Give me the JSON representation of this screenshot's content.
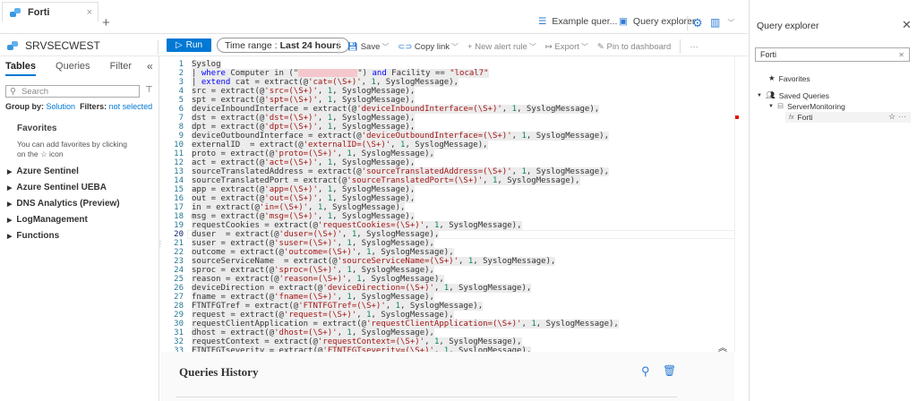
{
  "tab": {
    "title": "Forti",
    "close": "×",
    "new_tab": "+"
  },
  "topbar": {
    "example_queries": "Example quer...",
    "query_explorer": "Query explorer"
  },
  "workspace": "SRVSECWEST",
  "toolbar": {
    "run": "Run",
    "time_range_label": "Time range :",
    "time_range_value": "Last 24 hours",
    "save": "Save",
    "copy_link": "Copy link",
    "new_alert_rule": "New alert rule",
    "export": "Export",
    "pin": "Pin to dashboard",
    "more": "···"
  },
  "left_panel": {
    "tabs": [
      "Tables",
      "Queries",
      "Filter"
    ],
    "active_tab": "Tables",
    "search_placeholder": "Search",
    "group_by_label": "Group by:",
    "group_by_value": "Solution",
    "filters_label": "Filters:",
    "filters_value": "not selected",
    "favorites_title": "Favorites",
    "favorites_hint": "You can add favorites by clicking on the ☆ icon",
    "categories": [
      "Azure Sentinel",
      "Azure Sentinel UEBA",
      "DNS Analytics (Preview)",
      "LogManagement",
      "Functions"
    ]
  },
  "editor": {
    "lines": [
      [
        [
          "p",
          "Syslog"
        ]
      ],
      [
        [
          "p",
          "| "
        ],
        [
          "k",
          "where"
        ],
        [
          "p",
          " Computer in (\""
        ],
        [
          "r",
          ""
        ],
        [
          "p",
          "\") "
        ],
        [
          "k",
          "and"
        ],
        [
          "p",
          " Facility == "
        ],
        [
          "s",
          "\"local7\""
        ]
      ],
      [
        [
          "p",
          "| "
        ],
        [
          "k",
          "extend"
        ],
        [
          "p",
          " cat = extract(@"
        ],
        [
          "s",
          "'cat=(\\S+)'"
        ],
        [
          "p",
          ", "
        ],
        [
          "n",
          "1"
        ],
        [
          "p",
          ", SyslogMessage),"
        ]
      ],
      [
        [
          "p",
          "src = extract(@"
        ],
        [
          "s",
          "'src=(\\S+)'"
        ],
        [
          "p",
          ", "
        ],
        [
          "n",
          "1"
        ],
        [
          "p",
          ", SyslogMessage),"
        ]
      ],
      [
        [
          "p",
          "spt = extract(@"
        ],
        [
          "s",
          "'spt=(\\S+)'"
        ],
        [
          "p",
          ", "
        ],
        [
          "n",
          "1"
        ],
        [
          "p",
          ", SyslogMessage),"
        ]
      ],
      [
        [
          "p",
          "deviceInboundInterface = extract(@"
        ],
        [
          "s",
          "'deviceInboundInterface=(\\S+)'"
        ],
        [
          "p",
          ", "
        ],
        [
          "n",
          "1"
        ],
        [
          "p",
          ", SyslogMessage),"
        ]
      ],
      [
        [
          "p",
          "dst = extract(@"
        ],
        [
          "s",
          "'dst=(\\S+)'"
        ],
        [
          "p",
          ", "
        ],
        [
          "n",
          "1"
        ],
        [
          "p",
          ", SyslogMessage),"
        ]
      ],
      [
        [
          "p",
          "dpt = extract(@"
        ],
        [
          "s",
          "'dpt=(\\S+)'"
        ],
        [
          "p",
          ", "
        ],
        [
          "n",
          "1"
        ],
        [
          "p",
          ", SyslogMessage),"
        ]
      ],
      [
        [
          "p",
          "deviceOutboundInterface = extract(@"
        ],
        [
          "s",
          "'deviceOutboundInterface=(\\S+)'"
        ],
        [
          "p",
          ", "
        ],
        [
          "n",
          "1"
        ],
        [
          "p",
          ", SyslogMessage),"
        ]
      ],
      [
        [
          "p",
          "externalID  = extract(@"
        ],
        [
          "s",
          "'externalID=(\\S+)'"
        ],
        [
          "p",
          ", "
        ],
        [
          "n",
          "1"
        ],
        [
          "p",
          ", SyslogMessage),"
        ]
      ],
      [
        [
          "p",
          "proto = extract(@"
        ],
        [
          "s",
          "'proto=(\\S+)'"
        ],
        [
          "p",
          ", "
        ],
        [
          "n",
          "1"
        ],
        [
          "p",
          ", SyslogMessage),"
        ]
      ],
      [
        [
          "p",
          "act = extract(@"
        ],
        [
          "s",
          "'act=(\\S+)'"
        ],
        [
          "p",
          ", "
        ],
        [
          "n",
          "1"
        ],
        [
          "p",
          ", SyslogMessage),"
        ]
      ],
      [
        [
          "p",
          "sourceTranslatedAddress = extract(@"
        ],
        [
          "s",
          "'sourceTranslatedAddress=(\\S+)'"
        ],
        [
          "p",
          ", "
        ],
        [
          "n",
          "1"
        ],
        [
          "p",
          ", SyslogMessage),"
        ]
      ],
      [
        [
          "p",
          "sourceTranslatedPort = extract(@"
        ],
        [
          "s",
          "'sourceTranslatedPort=(\\S+)'"
        ],
        [
          "p",
          ", "
        ],
        [
          "n",
          "1"
        ],
        [
          "p",
          ", SyslogMessage),"
        ]
      ],
      [
        [
          "p",
          "app = extract(@"
        ],
        [
          "s",
          "'app=(\\S+)'"
        ],
        [
          "p",
          ", "
        ],
        [
          "n",
          "1"
        ],
        [
          "p",
          ", SyslogMessage),"
        ]
      ],
      [
        [
          "p",
          "out = extract(@"
        ],
        [
          "s",
          "'out=(\\S+)'"
        ],
        [
          "p",
          ", "
        ],
        [
          "n",
          "1"
        ],
        [
          "p",
          ", SyslogMessage),"
        ]
      ],
      [
        [
          "p",
          "in = extract(@"
        ],
        [
          "s",
          "'in=(\\S+)'"
        ],
        [
          "p",
          ", "
        ],
        [
          "n",
          "1"
        ],
        [
          "p",
          ", SyslogMessage),"
        ]
      ],
      [
        [
          "p",
          "msg = extract(@"
        ],
        [
          "s",
          "'msg=(\\S+)'"
        ],
        [
          "p",
          ", "
        ],
        [
          "n",
          "1"
        ],
        [
          "p",
          ", SyslogMessage),"
        ]
      ],
      [
        [
          "p",
          "requestCookies = extract(@"
        ],
        [
          "s",
          "'requestCookies=(\\S+)'"
        ],
        [
          "p",
          ", "
        ],
        [
          "n",
          "1"
        ],
        [
          "p",
          ", SyslogMessage),"
        ]
      ],
      [
        [
          "p",
          "duser  = extract(@"
        ],
        [
          "s",
          "'duser=(\\S+)'"
        ],
        [
          "p",
          ", "
        ],
        [
          "n",
          "1"
        ],
        [
          "p",
          ", SyslogMessage),"
        ]
      ],
      [
        [
          "p",
          "suser = extract(@"
        ],
        [
          "s",
          "'suser=(\\S+)'"
        ],
        [
          "p",
          ", "
        ],
        [
          "n",
          "1"
        ],
        [
          "p",
          ", SyslogMessage),"
        ]
      ],
      [
        [
          "p",
          "outcome = extract(@"
        ],
        [
          "s",
          "'outcome=(\\S+)'"
        ],
        [
          "p",
          ", "
        ],
        [
          "n",
          "1"
        ],
        [
          "p",
          ", SyslogMessage),"
        ]
      ],
      [
        [
          "p",
          "sourceServiceName  = extract(@"
        ],
        [
          "s",
          "'sourceServiceName=(\\S+)'"
        ],
        [
          "p",
          ", "
        ],
        [
          "n",
          "1"
        ],
        [
          "p",
          ", SyslogMessage),"
        ]
      ],
      [
        [
          "p",
          "sproc = extract(@"
        ],
        [
          "s",
          "'sproc=(\\S+)'"
        ],
        [
          "p",
          ", "
        ],
        [
          "n",
          "1"
        ],
        [
          "p",
          ", SyslogMessage),"
        ]
      ],
      [
        [
          "p",
          "reason = extract(@"
        ],
        [
          "s",
          "'reason=(\\S+)'"
        ],
        [
          "p",
          ", "
        ],
        [
          "n",
          "1"
        ],
        [
          "p",
          ", SyslogMessage),"
        ]
      ],
      [
        [
          "p",
          "deviceDirection = extract(@"
        ],
        [
          "s",
          "'deviceDirection=(\\S+)'"
        ],
        [
          "p",
          ", "
        ],
        [
          "n",
          "1"
        ],
        [
          "p",
          ", SyslogMessage),"
        ]
      ],
      [
        [
          "p",
          "fname = extract(@"
        ],
        [
          "s",
          "'fname=(\\S+)'"
        ],
        [
          "p",
          ", "
        ],
        [
          "n",
          "1"
        ],
        [
          "p",
          ", SyslogMessage),"
        ]
      ],
      [
        [
          "p",
          "FTNTFGTref = extract(@"
        ],
        [
          "s",
          "'FTNTFGTref=(\\S+)'"
        ],
        [
          "p",
          ", "
        ],
        [
          "n",
          "1"
        ],
        [
          "p",
          ", SyslogMessage),"
        ]
      ],
      [
        [
          "p",
          "request = extract(@"
        ],
        [
          "s",
          "'request=(\\S+)'"
        ],
        [
          "p",
          ", "
        ],
        [
          "n",
          "1"
        ],
        [
          "p",
          ", SyslogMessage),"
        ]
      ],
      [
        [
          "p",
          "requestClientApplication = extract(@"
        ],
        [
          "s",
          "'requestClientApplication=(\\S+)'"
        ],
        [
          "p",
          ", "
        ],
        [
          "n",
          "1"
        ],
        [
          "p",
          ", SyslogMessage),"
        ]
      ],
      [
        [
          "p",
          "dhost = extract(@"
        ],
        [
          "s",
          "'dhost=(\\S+)'"
        ],
        [
          "p",
          ", "
        ],
        [
          "n",
          "1"
        ],
        [
          "p",
          ", SyslogMessage),"
        ]
      ],
      [
        [
          "p",
          "requestContext = extract(@"
        ],
        [
          "s",
          "'requestContext=(\\S+)'"
        ],
        [
          "p",
          ", "
        ],
        [
          "n",
          "1"
        ],
        [
          "p",
          ", SyslogMessage),"
        ]
      ],
      [
        [
          "p",
          "FTNTFGTseverity = extract(@"
        ],
        [
          "s",
          "'FTNTFGTseverity=(\\S+)'"
        ],
        [
          "p",
          ", "
        ],
        [
          "n",
          "1"
        ],
        [
          "p",
          ", SyslogMessage),"
        ]
      ]
    ],
    "current_line": 20
  },
  "history": {
    "title": "Queries History"
  },
  "query_explorer": {
    "title": "Query explorer",
    "search_value": "Forti",
    "favorites": "Favorites",
    "saved_queries": "Saved Queries",
    "folder": "ServerMonitoring",
    "item": "Forti",
    "item_more": "···"
  },
  "colors": {
    "accent": "#0078d4",
    "keyword": "#0000ff",
    "string": "#a31515",
    "number": "#098658"
  }
}
